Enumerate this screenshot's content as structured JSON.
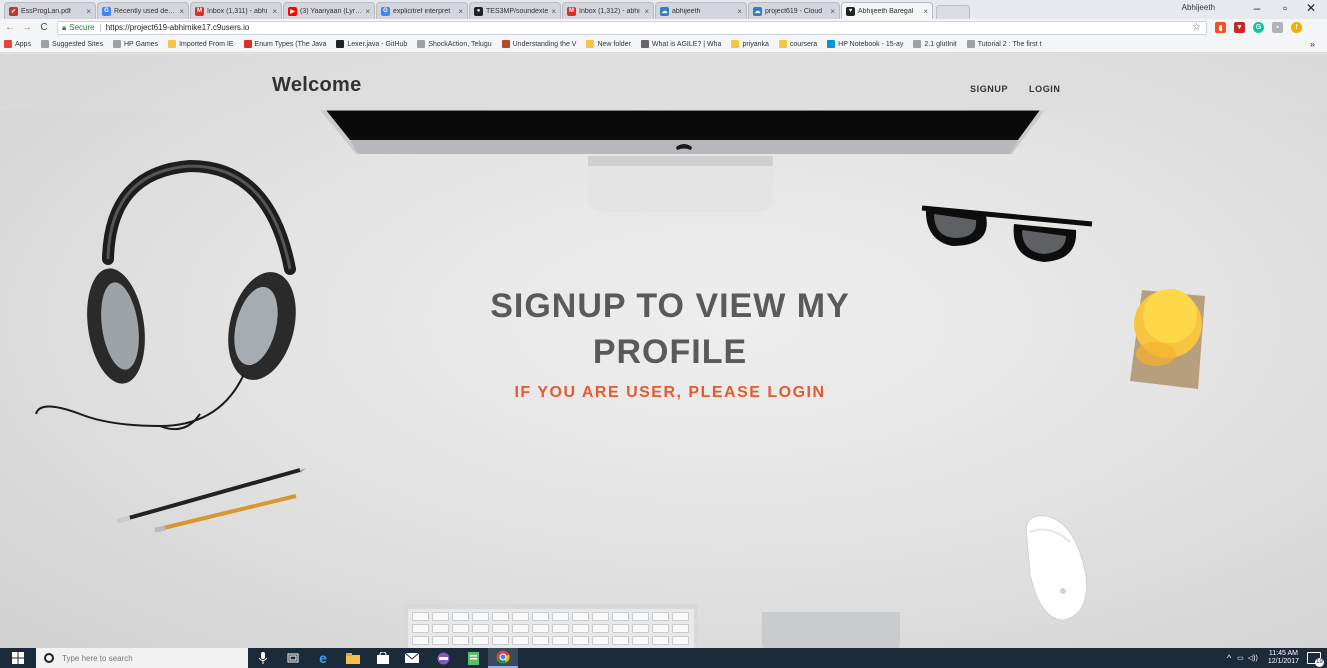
{
  "browser": {
    "tabs": [
      {
        "title": "EssProgLan.pdf",
        "fav": "pdf-icon",
        "color": "#c0392b",
        "glyph": "✔"
      },
      {
        "title": "Recently used devic",
        "fav": "google-icon",
        "color": "#4285f4",
        "glyph": "G"
      },
      {
        "title": "Inbox (1,311) - abhi",
        "fav": "gmail-icon",
        "color": "#d93025",
        "glyph": "M"
      },
      {
        "title": "(3) Yaariyaan (Lyrics",
        "fav": "youtube-icon",
        "color": "#ff0000",
        "glyph": "▶"
      },
      {
        "title": "explicitref interpret",
        "fav": "google-icon",
        "color": "#4285f4",
        "glyph": "G"
      },
      {
        "title": "TES3MP/soundexte",
        "fav": "github-icon",
        "color": "#222222",
        "glyph": "●"
      },
      {
        "title": "Inbox (1,312) - abhi",
        "fav": "gmail-icon",
        "color": "#d93025",
        "glyph": "M"
      },
      {
        "title": "abhijeeth",
        "fav": "cloud9-icon",
        "color": "#2f80c2",
        "glyph": "☁"
      },
      {
        "title": "project619 - Cloud",
        "fav": "cloud9-icon",
        "color": "#2f80c2",
        "glyph": "☁"
      },
      {
        "title": "Abhijeeth Baregal",
        "fav": "heart-icon",
        "color": "#222222",
        "glyph": "♥"
      }
    ],
    "user_label": "Abhijeeth",
    "address": {
      "secure_label": "Secure",
      "url": "https://project619-abhimike17.c9users.io"
    },
    "bookmarks": [
      {
        "label": "Apps",
        "color": "#e8453c"
      },
      {
        "label": "Suggested Sites",
        "color": "#9aa0a6"
      },
      {
        "label": "HP Games",
        "color": "#9aa0a6"
      },
      {
        "label": "Imported From IE",
        "color": "#f6c544"
      },
      {
        "label": "Enum Types (The Java",
        "color": "#d93025"
      },
      {
        "label": "Lexer.java - GitHub",
        "color": "#222222"
      },
      {
        "label": "ShockAction, Telugu",
        "color": "#9aa0a6"
      },
      {
        "label": "Understanding the V",
        "color": "#b5492d"
      },
      {
        "label": "New folder",
        "color": "#f6c544"
      },
      {
        "label": "What is AGILE? | Wha",
        "color": "#666666"
      },
      {
        "label": "priyanka",
        "color": "#f6c544"
      },
      {
        "label": "coursera",
        "color": "#f6c544"
      },
      {
        "label": "HP Notebook - 15-ay",
        "color": "#0096d6"
      },
      {
        "label": "2.1 glutInit",
        "color": "#9aa0a6"
      },
      {
        "label": "Tutorial 2 : The first t",
        "color": "#9aa0a6"
      }
    ]
  },
  "site": {
    "brand": "Welcome",
    "nav": {
      "signup": "SIGNUP",
      "login": "LOGIN"
    },
    "heading_line1": "SIGNUP TO VIEW MY",
    "heading_line2": "PROFILE",
    "subheading": "IF YOU ARE USER, PLEASE LOGIN"
  },
  "taskbar": {
    "search_placeholder": "Type here to search",
    "time": "11:45 AM",
    "date": "12/1/2017",
    "notification_count": "19"
  },
  "colors": {
    "accent": "#e35b2f",
    "heading": "#5a5a5a",
    "taskbar": "#1c2b3a"
  }
}
